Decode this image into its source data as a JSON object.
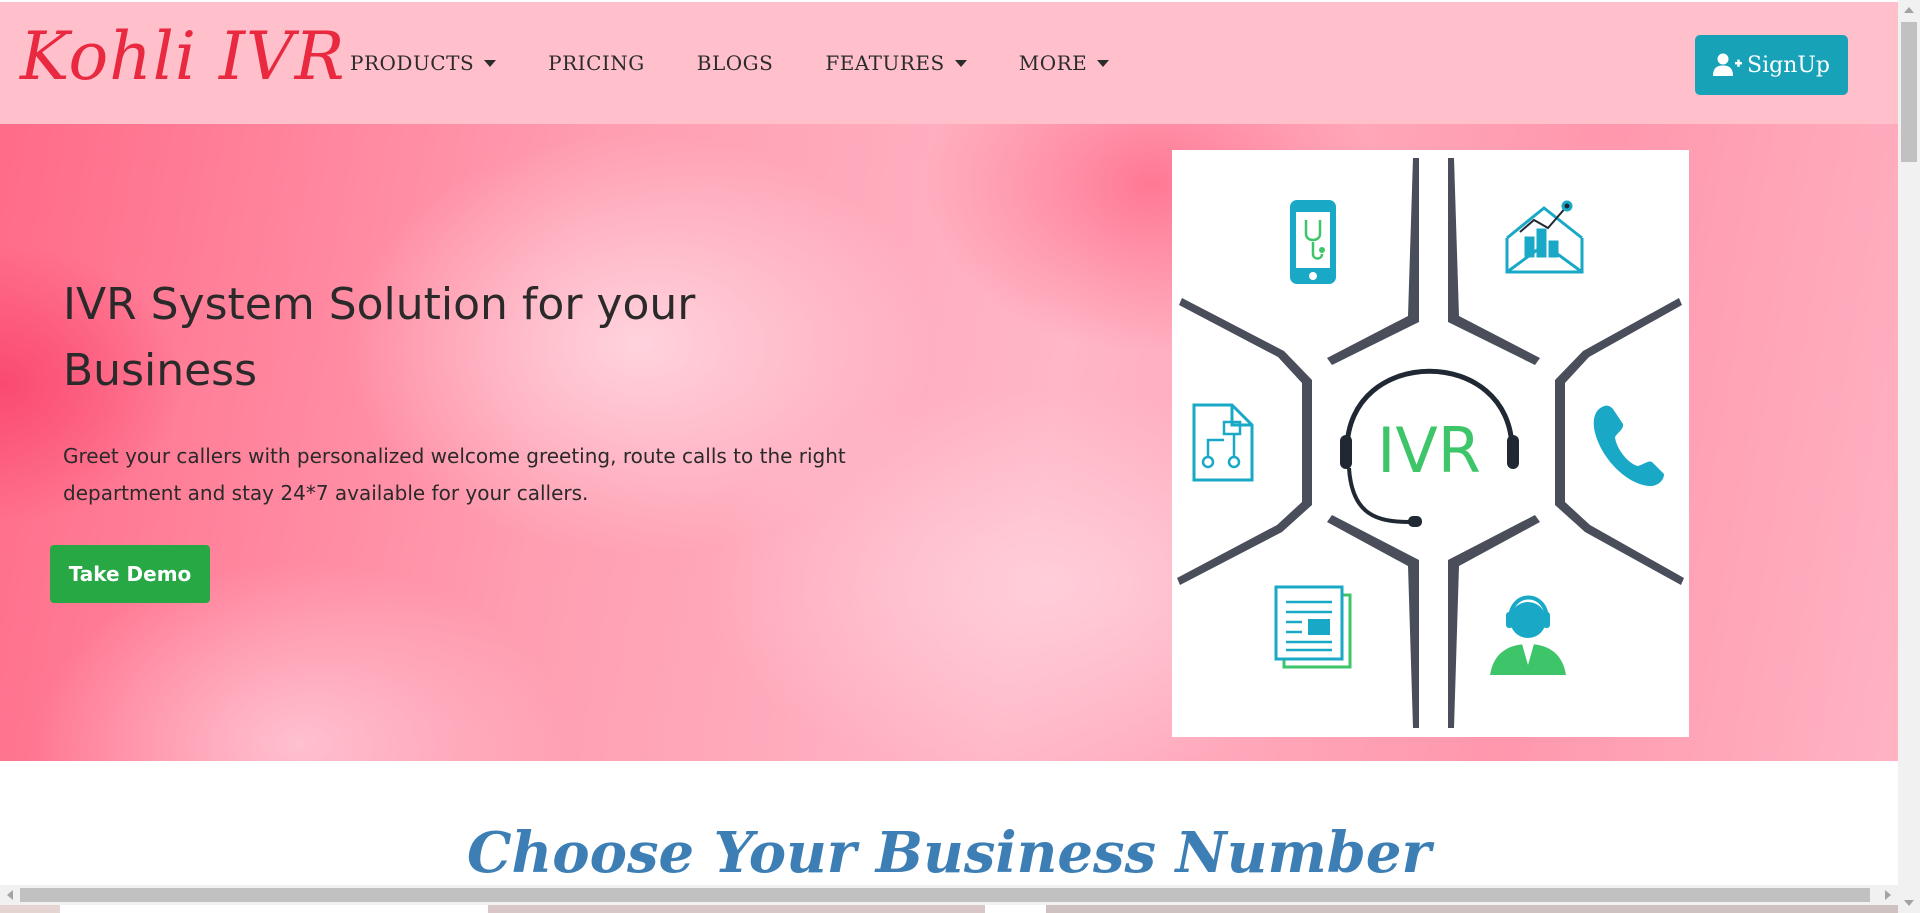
{
  "navbar": {
    "brand": "Kohli IVR",
    "items": [
      {
        "label": "PRODUCTS",
        "has_dropdown": true
      },
      {
        "label": "PRICING",
        "has_dropdown": false
      },
      {
        "label": "BLOGS",
        "has_dropdown": false
      },
      {
        "label": "FEATURES",
        "has_dropdown": true
      },
      {
        "label": "MORE",
        "has_dropdown": true
      }
    ],
    "signup_label": "SignUp",
    "signup_icon": "user-plus-icon"
  },
  "hero": {
    "title": "IVR System Solution for your Business",
    "description": "Greet your callers with personalized welcome greeting, route calls to the right department and stay 24*7 available for your callers.",
    "cta_label": "Take Demo",
    "image_center_text": "IVR"
  },
  "section": {
    "heading": "Choose Your Business Number"
  },
  "colors": {
    "navbar_bg": "#ffc0cb",
    "brand": "#e8293f",
    "signup_bg": "#17a2b8",
    "demo_bg": "#28a745",
    "heading": "#3d7fb5",
    "icon_teal": "#19a9c6",
    "icon_green": "#3ec56a"
  }
}
